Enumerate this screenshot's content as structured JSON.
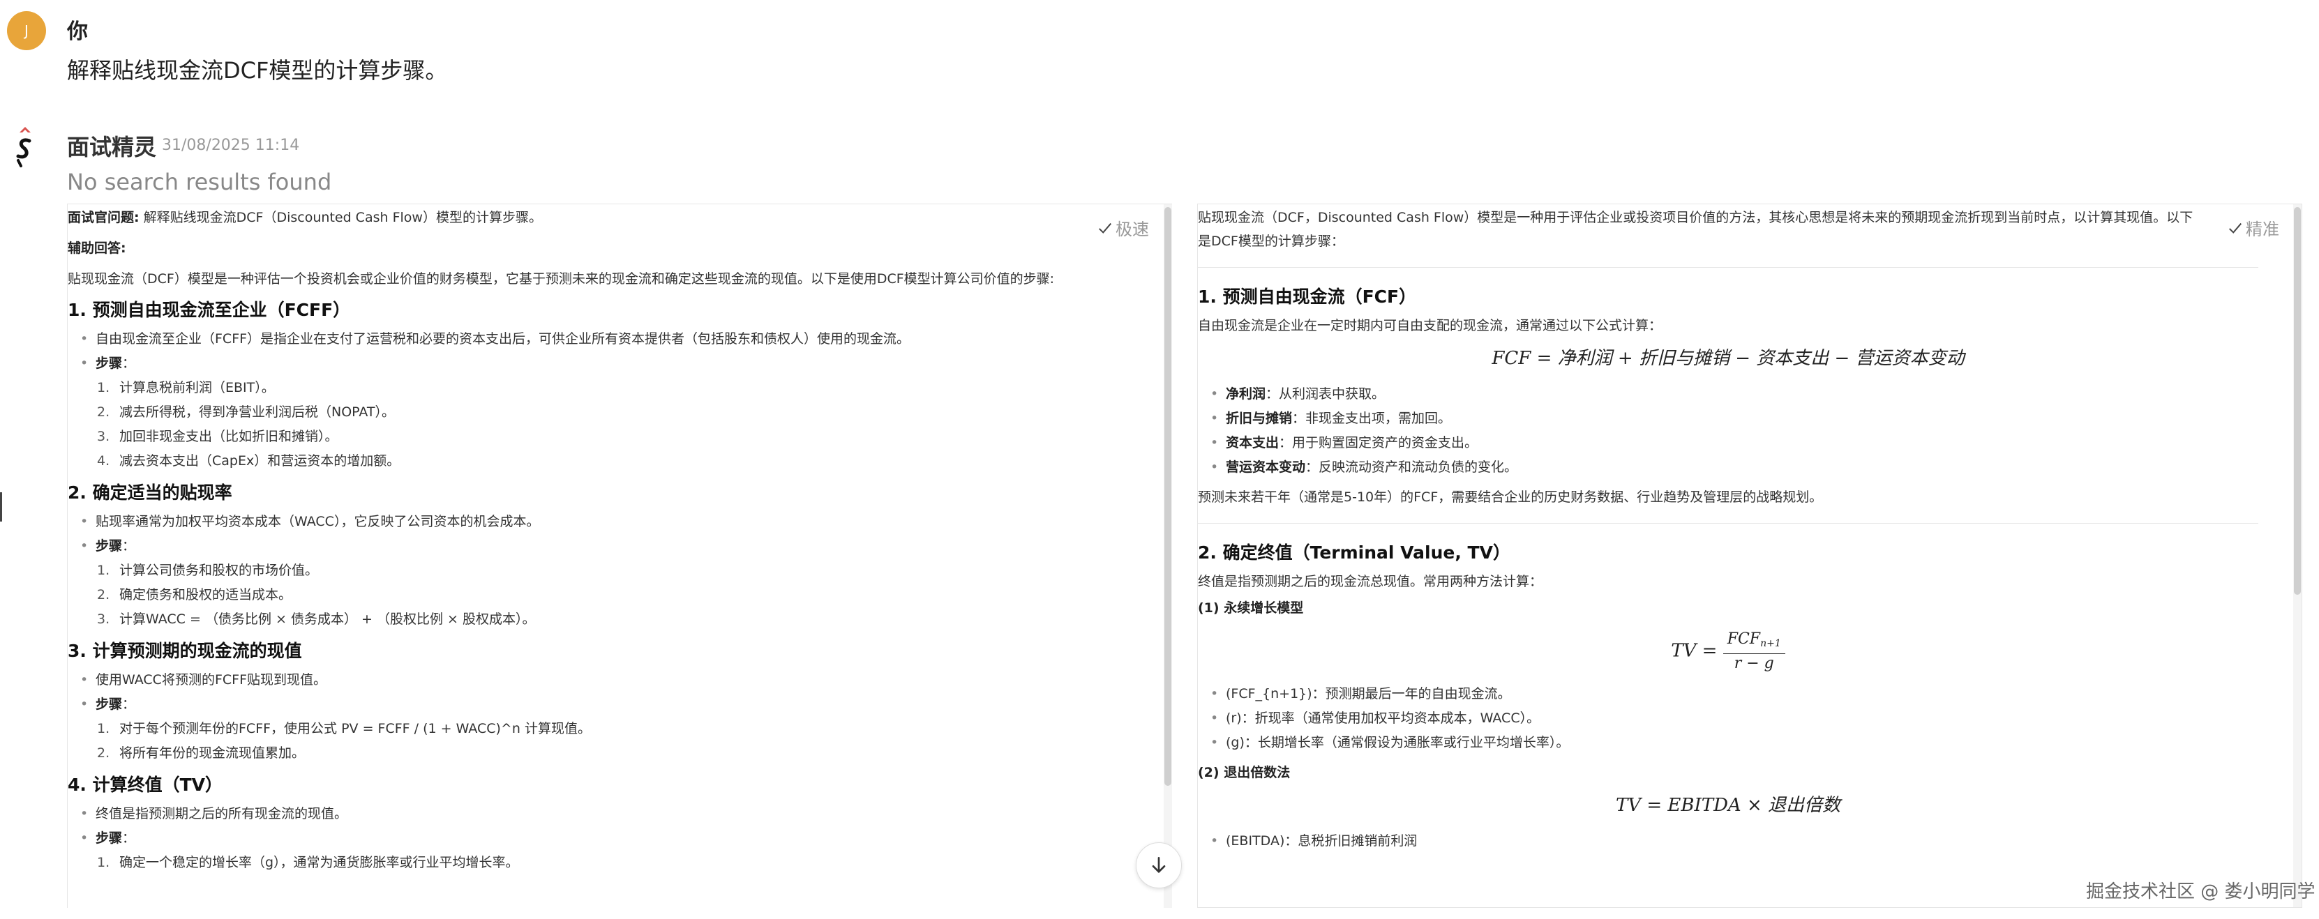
{
  "user": {
    "avatar_letter": "J",
    "name": "你",
    "message": "解释贴线现金流DCF模型的计算步骤。"
  },
  "bot": {
    "name": "面试精灵",
    "time": "31/08/2025 11:14",
    "no_results": "No search results found"
  },
  "left_panel": {
    "mode": "极速",
    "question_label": "面试官问题:",
    "question_text": " 解释贴线现金流DCF（Discounted Cash Flow）模型的计算步骤。",
    "aux_label": "辅助回答:",
    "intro": "贴现现金流（DCF）模型是一种评估一个投资机会或企业价值的财务模型，它基于预测未来的现金流和确定这些现金流的现值。以下是使用DCF模型计算公司价值的步骤:",
    "s1": {
      "title": "1. 预测自由现金流至企业（FCFF）",
      "b1": "自由现金流至企业（FCFF）是指企业在支付了运营税和必要的资本支出后，可供企业所有资本提供者（包括股东和债权人）使用的现金流。",
      "steps_label": "步骤",
      "steps": [
        "计算息税前利润（EBIT）。",
        "减去所得税，得到净营业利润后税（NOPAT）。",
        "加回非现金支出（比如折旧和摊销）。",
        "减去资本支出（CapEx）和营运资本的增加额。"
      ]
    },
    "s2": {
      "title": "2. 确定适当的贴现率",
      "b1": "贴现率通常为加权平均资本成本（WACC），它反映了公司资本的机会成本。",
      "steps_label": "步骤",
      "steps": [
        "计算公司债务和股权的市场价值。",
        "确定债务和股权的适当成本。",
        "计算WACC = （债务比例 × 债务成本） + （股权比例 × 股权成本）。"
      ]
    },
    "s3": {
      "title": "3. 计算预测期的现金流的现值",
      "b1": "使用WACC将预测的FCFF贴现到现值。",
      "steps_label": "步骤",
      "steps": [
        "对于每个预测年份的FCFF，使用公式 PV = FCFF / (1 + WACC)^n 计算现值。",
        "将所有年份的现金流现值累加。"
      ]
    },
    "s4": {
      "title": "4. 计算终值（TV）",
      "b1": "终值是指预测期之后的所有现金流的现值。",
      "steps_label": "步骤",
      "steps": [
        "确定一个稳定的增长率（g），通常为通货膨胀率或行业平均增长率。"
      ]
    }
  },
  "right_panel": {
    "mode": "精准",
    "intro": "贴现现金流（DCF，Discounted Cash Flow）模型是一种用于评估企业或投资项目价值的方法，其核心思想是将未来的预期现金流折现到当前时点，以计算其现值。以下是DCF模型的计算步骤：",
    "s1": {
      "title": "1. 预测自由现金流（FCF）",
      "desc": "自由现金流是企业在一定时期内可自由支配的现金流，通常通过以下公式计算：",
      "formula": "FCF = 净利润 + 折旧与摊销 − 资本支出 − 营运资本变动",
      "items": [
        {
          "label": "净利润",
          "text": "：从利润表中获取。"
        },
        {
          "label": "折旧与摊销",
          "text": "：非现金支出项，需加回。"
        },
        {
          "label": "资本支出",
          "text": "：用于购置固定资产的资金支出。"
        },
        {
          "label": "营运资本变动",
          "text": "：反映流动资产和流动负债的变化。"
        }
      ],
      "note": "预测未来若干年（通常是5-10年）的FCF，需要结合企业的历史财务数据、行业趋势及管理层的战略规划。"
    },
    "s2": {
      "title": "2. 确定终值（Terminal Value, TV）",
      "desc": "终值是指预测期之后的现金流总现值。常用两种方法计算：",
      "m1_title": "(1) 永续增长模型",
      "tv_lhs": "TV =",
      "tv_num": "FCF",
      "tv_sub": "n+1",
      "tv_den": "r − g",
      "m1_items": [
        "(FCF_{n+1})：预测期最后一年的自由现金流。",
        "(r)：折现率（通常使用加权平均资本成本，WACC）。",
        "(g)：长期增长率（通常假设为通胀率或行业平均增长率）。"
      ],
      "m2_title": "(2) 退出倍数法",
      "formula2": "TV = EBITDA × 退出倍数",
      "m2_items": [
        "(EBITDA)：息税折旧摊销前利润"
      ]
    }
  },
  "watermark": "掘金技术社区 @ 娄小明同学",
  "colors": {
    "avatar": "#e8a53a",
    "muted": "#999999"
  }
}
